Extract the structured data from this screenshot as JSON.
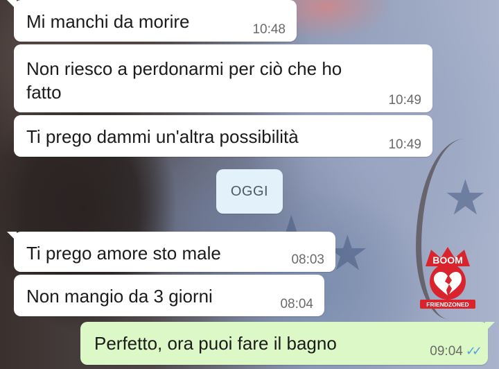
{
  "messages": [
    {
      "text": "Mi manchi da morire",
      "time": "10:48",
      "direction": "incoming"
    },
    {
      "text_line1": "Non riesco a perdonarmi per ciò che ho",
      "text_line2": "fatto",
      "time": "10:49",
      "direction": "incoming"
    },
    {
      "text": "Ti prego dammi un'altra possibilità",
      "time": "10:49",
      "direction": "incoming"
    },
    {
      "text": "Ti prego amore sto male",
      "time": "08:03",
      "direction": "incoming"
    },
    {
      "text": "Non mangio da 3 giorni",
      "time": "08:04",
      "direction": "incoming"
    },
    {
      "text": "Perfetto, ora puoi fare il bagno",
      "time": "09:04",
      "direction": "outgoing",
      "status_icon": "double-check-read-icon"
    }
  ],
  "date_separator": "OGGI",
  "watermark": {
    "top_text": "BOOM",
    "bottom_text": "FRIENDZONED",
    "icon": "broken-heart-icon"
  },
  "colors": {
    "incoming_bubble": "#ffffff",
    "outgoing_bubble": "#dcf8c6",
    "date_chip": "#e3f1fa",
    "read_ticks": "#4fa3e0",
    "watermark_red": "#d9232d"
  }
}
